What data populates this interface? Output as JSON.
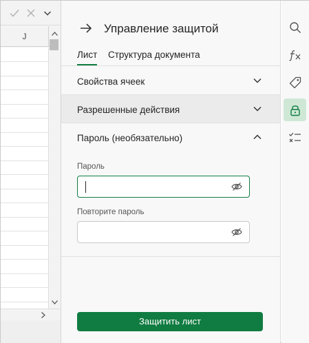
{
  "formula_bar": {
    "confirm_icon": "checkmark-icon",
    "cancel_icon": "close-icon",
    "expand_icon": "chevron-down-icon"
  },
  "sheet": {
    "column_header": "J"
  },
  "pane": {
    "back_icon": "arrow-right-icon",
    "title": "Управление защитой",
    "tabs": [
      {
        "label": "Лист",
        "active": true
      },
      {
        "label": "Структура документа",
        "active": false
      }
    ],
    "sections": [
      {
        "label": "Свойства ячеек",
        "expanded": false
      },
      {
        "label": "Разрешенные действия",
        "expanded": false
      },
      {
        "label": "Пароль (необязательно)",
        "expanded": true
      }
    ],
    "password": {
      "label": "Пароль",
      "value": "",
      "reveal_icon": "eye-off-icon"
    },
    "confirm_password": {
      "label": "Повторите пароль",
      "value": "",
      "reveal_icon": "eye-off-icon"
    },
    "protect_button": "Защитить лист"
  },
  "rail": {
    "items": [
      {
        "icon": "search-icon",
        "active": false
      },
      {
        "icon": "function-icon",
        "active": false
      },
      {
        "icon": "tag-icon",
        "active": false
      },
      {
        "icon": "lock-icon",
        "active": true
      },
      {
        "icon": "checklist-icon",
        "active": false
      }
    ]
  },
  "colors": {
    "accent": "#107c41",
    "active_rail_bg": "#cfe8d6",
    "highlight_section_bg": "#ebebeb"
  }
}
